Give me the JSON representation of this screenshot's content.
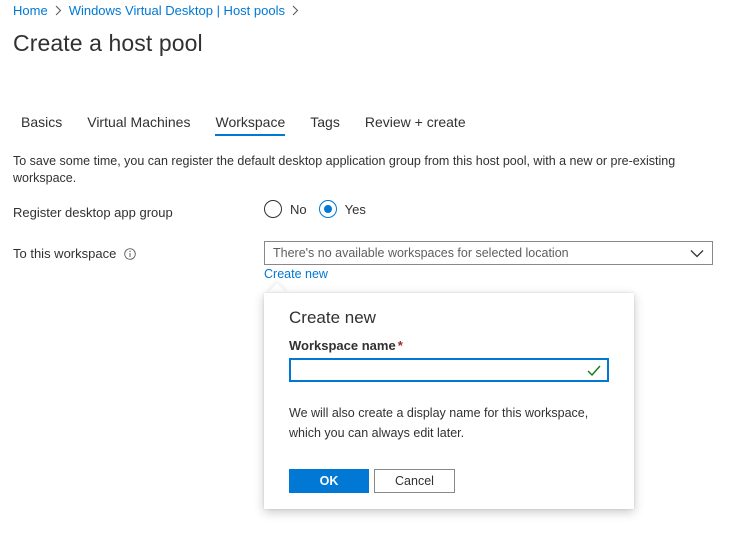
{
  "breadcrumb": {
    "items": [
      "Home",
      "Windows Virtual Desktop | Host pools"
    ]
  },
  "page": {
    "title": "Create a host pool"
  },
  "tabs": [
    {
      "label": "Basics",
      "active": false
    },
    {
      "label": "Virtual Machines",
      "active": false
    },
    {
      "label": "Workspace",
      "active": true
    },
    {
      "label": "Tags",
      "active": false
    },
    {
      "label": "Review + create",
      "active": false
    }
  ],
  "intro": {
    "text": "To save some time, you can register the default desktop application group from this host pool, with a new or pre-existing workspace."
  },
  "register": {
    "label": "Register desktop app group",
    "options": [
      "No",
      "Yes"
    ],
    "selected": "Yes"
  },
  "workspace": {
    "label": "To this workspace",
    "dropdown_text": "There's no available workspaces for selected location",
    "create_new_link": "Create new"
  },
  "create_new_panel": {
    "title": "Create new",
    "field_label": "Workspace name",
    "required_mark": "*",
    "field_value": "",
    "description": "We will also create a display name for this workspace, which you can always edit later.",
    "ok_label": "OK",
    "cancel_label": "Cancel"
  },
  "colors": {
    "accent": "#0078d4",
    "success": "#107c10",
    "required": "#a4262c"
  }
}
